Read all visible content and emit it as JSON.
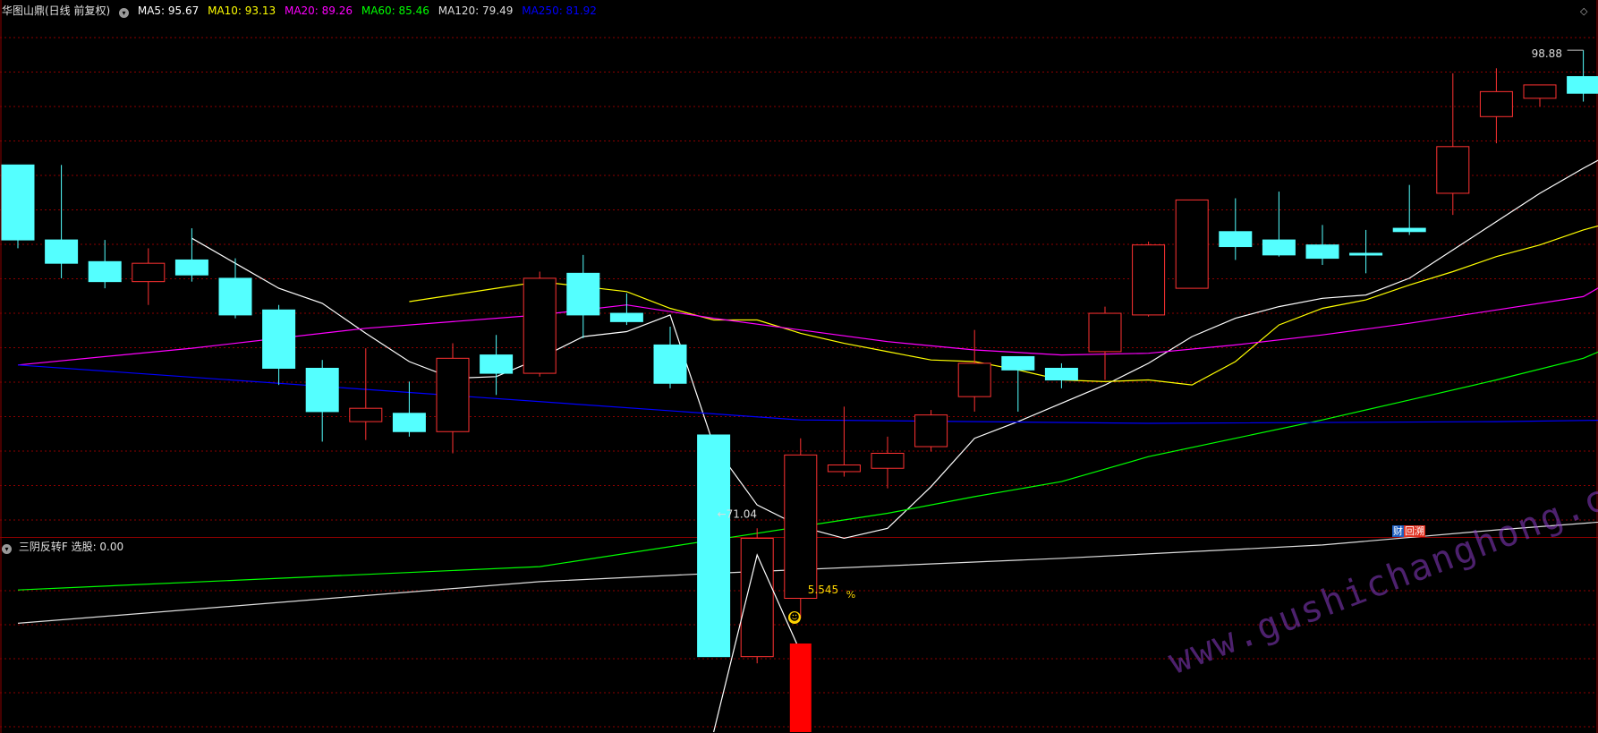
{
  "header": {
    "title": "华图山鼎(日线 前复权)",
    "ma": [
      {
        "label": "MA5: 95.67",
        "color": "#ffffff"
      },
      {
        "label": "MA10: 93.13",
        "color": "#ffff00"
      },
      {
        "label": "MA20: 89.26",
        "color": "#ff00ff"
      },
      {
        "label": "MA60: 85.46",
        "color": "#00ff00"
      },
      {
        "label": "MA120: 79.49",
        "color": "#dddddd"
      },
      {
        "label": "MA250: 81.92",
        "color": "#0000ff"
      }
    ]
  },
  "indicator_header": {
    "name": "三阴反转F",
    "value_label": "选股: 0.00"
  },
  "badge": {
    "part1": "财",
    "part2": "回溯"
  },
  "annotations": {
    "high": "98.88",
    "low": "71.04",
    "pct": "5.545",
    "pct_unit": "%"
  },
  "watermark": "www.gushichanghong.com",
  "colors": {
    "up": "#ff3232",
    "down": "#54ffff",
    "grid": "#8b0000",
    "separator": "#8b0000",
    "signal_bar": "#ff0000",
    "signal_line": "#ffffff",
    "pct_text": "#ffd700"
  },
  "chart_data": {
    "type": "candlestick",
    "price_range": [
      70.0,
      100.5
    ],
    "candles": [
      {
        "o": 92.0,
        "h": 92.0,
        "l": 87.0,
        "c": 87.5
      },
      {
        "o": 87.5,
        "h": 92.0,
        "l": 85.2,
        "c": 86.1
      },
      {
        "o": 86.2,
        "h": 87.5,
        "l": 84.6,
        "c": 85.0
      },
      {
        "o": 85.0,
        "h": 87.0,
        "l": 83.6,
        "c": 86.1
      },
      {
        "o": 86.3,
        "h": 88.2,
        "l": 85.0,
        "c": 85.4
      },
      {
        "o": 85.2,
        "h": 86.4,
        "l": 82.8,
        "c": 83.0
      },
      {
        "o": 83.3,
        "h": 83.6,
        "l": 78.8,
        "c": 79.8
      },
      {
        "o": 79.8,
        "h": 80.3,
        "l": 75.4,
        "c": 77.2
      },
      {
        "o": 76.6,
        "h": 81.0,
        "l": 75.5,
        "c": 77.4
      },
      {
        "o": 77.1,
        "h": 79.0,
        "l": 75.7,
        "c": 76.0
      },
      {
        "o": 76.0,
        "h": 81.3,
        "l": 74.7,
        "c": 80.4
      },
      {
        "o": 80.6,
        "h": 81.8,
        "l": 78.2,
        "c": 79.5
      },
      {
        "o": 79.5,
        "h": 85.6,
        "l": 79.3,
        "c": 85.2
      },
      {
        "o": 85.5,
        "h": 86.6,
        "l": 81.6,
        "c": 83.0
      },
      {
        "o": 83.1,
        "h": 84.3,
        "l": 82.4,
        "c": 82.6
      },
      {
        "o": 81.2,
        "h": 82.3,
        "l": 78.6,
        "c": 78.9
      },
      {
        "o": 75.8,
        "h": 75.8,
        "l": 71.04,
        "c": 62.5
      },
      {
        "o": 62.5,
        "h": 70.2,
        "l": 62.1,
        "c": 69.6
      },
      {
        "o": 66.0,
        "h": 75.6,
        "l": 64.8,
        "c": 74.6
      },
      {
        "o": 73.6,
        "h": 77.5,
        "l": 73.3,
        "c": 74.0
      },
      {
        "o": 73.8,
        "h": 75.7,
        "l": 72.6,
        "c": 74.7
      },
      {
        "o": 75.1,
        "h": 77.3,
        "l": 74.8,
        "c": 77.0
      },
      {
        "o": 78.1,
        "h": 82.1,
        "l": 77.2,
        "c": 80.1
      },
      {
        "o": 80.5,
        "h": 80.5,
        "l": 77.2,
        "c": 79.7
      },
      {
        "o": 79.8,
        "h": 80.1,
        "l": 78.6,
        "c": 79.1
      },
      {
        "o": 80.8,
        "h": 83.5,
        "l": 79.1,
        "c": 83.1
      },
      {
        "o": 83.0,
        "h": 87.4,
        "l": 82.9,
        "c": 87.2
      },
      {
        "o": 84.6,
        "h": 89.9,
        "l": 84.6,
        "c": 89.9
      },
      {
        "o": 88.0,
        "h": 90.0,
        "l": 86.3,
        "c": 87.1
      },
      {
        "o": 87.5,
        "h": 90.4,
        "l": 86.5,
        "c": 86.6
      },
      {
        "o": 87.2,
        "h": 88.4,
        "l": 86.0,
        "c": 86.4
      },
      {
        "o": 86.7,
        "h": 88.1,
        "l": 85.5,
        "c": 86.6
      },
      {
        "o": 88.2,
        "h": 90.8,
        "l": 87.8,
        "c": 88.0
      },
      {
        "o": 90.3,
        "h": 97.5,
        "l": 89.0,
        "c": 93.1
      },
      {
        "o": 94.9,
        "h": 97.8,
        "l": 93.3,
        "c": 96.4
      },
      {
        "o": 96.0,
        "h": 96.8,
        "l": 95.5,
        "c": 96.8
      },
      {
        "o": 97.3,
        "h": 98.88,
        "l": 95.8,
        "c": 96.3
      },
      {
        "o": 96.2,
        "h": 97.6,
        "l": 93.1,
        "c": 96.2
      }
    ],
    "ma_lines": [
      {
        "name": "MA5",
        "color": "#ffffff",
        "values": [
          null,
          null,
          null,
          null,
          87.6,
          86.1,
          84.6,
          83.7,
          81.9,
          80.2,
          79.2,
          79.3,
          80.4,
          81.7,
          82.0,
          83.0,
          75.2,
          71.6,
          70.3,
          69.6,
          70.2,
          72.7,
          75.6,
          76.6,
          77.7,
          78.8,
          80.1,
          81.7,
          82.8,
          83.5,
          84.0,
          84.2,
          85.2,
          86.9,
          88.6,
          90.3,
          91.8,
          93.2
        ]
      },
      {
        "name": "MA10",
        "color": "#ffff00",
        "values": [
          null,
          null,
          null,
          null,
          null,
          null,
          null,
          null,
          null,
          83.8,
          84.2,
          84.6,
          85.0,
          84.7,
          84.4,
          83.4,
          82.7,
          82.7,
          81.9,
          81.3,
          80.8,
          80.3,
          80.2,
          79.7,
          79.1,
          79.0,
          79.1,
          78.8,
          80.2,
          82.4,
          83.4,
          83.9,
          84.8,
          85.6,
          86.5,
          87.2,
          88.1,
          88.8
        ]
      },
      {
        "name": "MA20",
        "color": "#ff00ff",
        "values": [
          80.0,
          null,
          null,
          null,
          81.0,
          null,
          null,
          null,
          82.2,
          null,
          null,
          null,
          83.0,
          null,
          83.6,
          null,
          82.8,
          null,
          82.1,
          null,
          81.4,
          null,
          80.9,
          null,
          80.6,
          null,
          80.7,
          null,
          81.2,
          null,
          81.8,
          null,
          82.5,
          null,
          83.3,
          null,
          84.1,
          85.6
        ]
      },
      {
        "name": "MA60",
        "color": "#00ff00",
        "values": [
          66.5,
          null,
          null,
          null,
          null,
          null,
          null,
          null,
          null,
          null,
          null,
          null,
          67.9,
          null,
          null,
          null,
          69.5,
          null,
          70.3,
          null,
          71.1,
          null,
          72.1,
          null,
          73.0,
          null,
          74.5,
          null,
          75.6,
          null,
          76.7,
          null,
          77.9,
          null,
          79.1,
          null,
          80.4,
          81.5
        ]
      },
      {
        "name": "MA120",
        "color": "#dddddd",
        "values": [
          64.5,
          null,
          null,
          null,
          null,
          null,
          null,
          null,
          null,
          null,
          null,
          null,
          67.0,
          null,
          null,
          null,
          67.5,
          null,
          null,
          null,
          null,
          null,
          null,
          null,
          68.4,
          null,
          null,
          null,
          null,
          null,
          69.2,
          null,
          null,
          null,
          70.1,
          null,
          null,
          70.7
        ]
      },
      {
        "name": "MA250",
        "color": "#0000ff",
        "values": [
          80.0,
          null,
          null,
          null,
          null,
          null,
          null,
          null,
          null,
          null,
          null,
          null,
          null,
          null,
          null,
          null,
          null,
          null,
          76.7,
          null,
          null,
          null,
          null,
          null,
          null,
          null,
          76.5,
          null,
          null,
          null,
          null,
          null,
          null,
          null,
          76.6,
          null,
          null,
          76.7
        ]
      }
    ],
    "indicator": {
      "name": "三阴反转F",
      "signal_line": [
        {
          "i": 16,
          "v": 0
        },
        {
          "i": 17,
          "v": 1
        },
        {
          "i": 18,
          "v": 0.45
        }
      ],
      "signal_bar": {
        "i": 18,
        "v": 0.5
      },
      "pct": 5.545
    }
  }
}
